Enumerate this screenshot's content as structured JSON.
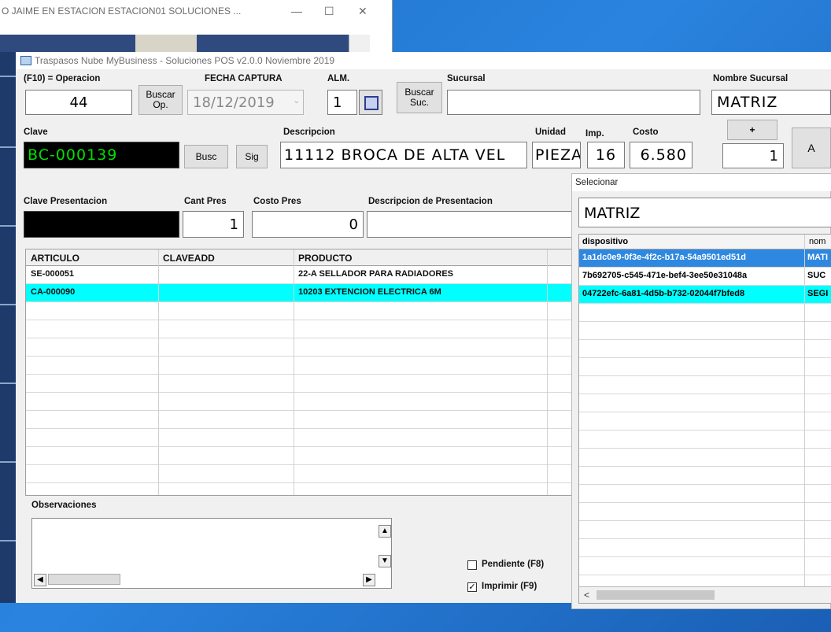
{
  "bg_window": {
    "title": "O JAIME EN ESTACION ESTACION01   SOLUCIONES ...",
    "min": "—",
    "max": "☐",
    "close": "✕"
  },
  "window": {
    "title": "Traspasos Nube MyBusiness - Soluciones POS v2.0.0 Noviembre 2019"
  },
  "form": {
    "operacion_label": "(F10) = Operacion",
    "operacion_value": "44",
    "buscar_op_label": "Buscar Op.",
    "fecha_label": "FECHA CAPTURA",
    "fecha_value": "18/12/2019",
    "alm_label": "ALM.",
    "alm_value": "1",
    "buscar_suc_label": "Buscar Suc.",
    "sucursal_label": "Sucursal",
    "sucursal_value": "",
    "nombre_sucursal_label": "Nombre Sucursal",
    "nombre_sucursal_value": "MATRIZ",
    "clave_label": "Clave",
    "clave_value": "BC-000139",
    "busc_label": "Busc",
    "sig_label": "Sig",
    "descripcion_label": "Descripcion",
    "descripcion_value": "11112 BROCA DE ALTA VEL",
    "unidad_label": "Unidad",
    "unidad_value": "PIEZA",
    "imp_label": "Imp.",
    "imp_value": "16",
    "costo_label": "Costo",
    "costo_value": "6.580",
    "plus_label": "+",
    "cantidad_value": "1",
    "add_label": "A",
    "clave_pres_label": "Clave Presentacion",
    "cant_pres_label": "Cant Pres",
    "cant_pres_value": "1",
    "costo_pres_label": "Costo Pres",
    "costo_pres_value": "0",
    "desc_pres_label": "Descripcion  de Presentacion"
  },
  "grid": {
    "columns": [
      "ARTICULO",
      "CLAVEADD",
      "PRODUCTO"
    ],
    "rows": [
      {
        "articulo": "SE-000051",
        "claveadd": "",
        "producto": "22-A SELLADOR PARA RADIADORES"
      },
      {
        "articulo": "CA-000090",
        "claveadd": "",
        "producto": "10203 EXTENCION ELECTRICA 6M"
      }
    ]
  },
  "observaciones_label": "Observaciones",
  "pendiente_label": "Pendiente (F8)",
  "pendiente_checked": false,
  "imprimir_label": "Imprimir  (F9)",
  "imprimir_checked": true,
  "dialog": {
    "title": "Selecionar",
    "search_value": "MATRIZ",
    "columns": [
      "dispositivo",
      "nom"
    ],
    "rows": [
      {
        "dispositivo": "1a1dc0e9-0f3e-4f2c-b17a-54a9501ed51d",
        "nombre": "MATI"
      },
      {
        "dispositivo": "7b692705-c545-471e-bef4-3ee50e31048a",
        "nombre": "SUC"
      },
      {
        "dispositivo": "04722efc-6a81-4d5b-b732-02044f7bfed8",
        "nombre": "SEGI"
      }
    ],
    "scroll_left": "<"
  },
  "colors": {
    "selected_row": "#00ffff",
    "dialog_selected": "#2f88e0",
    "clave_text": "#00e000",
    "desktop": "#1f6fc9"
  }
}
